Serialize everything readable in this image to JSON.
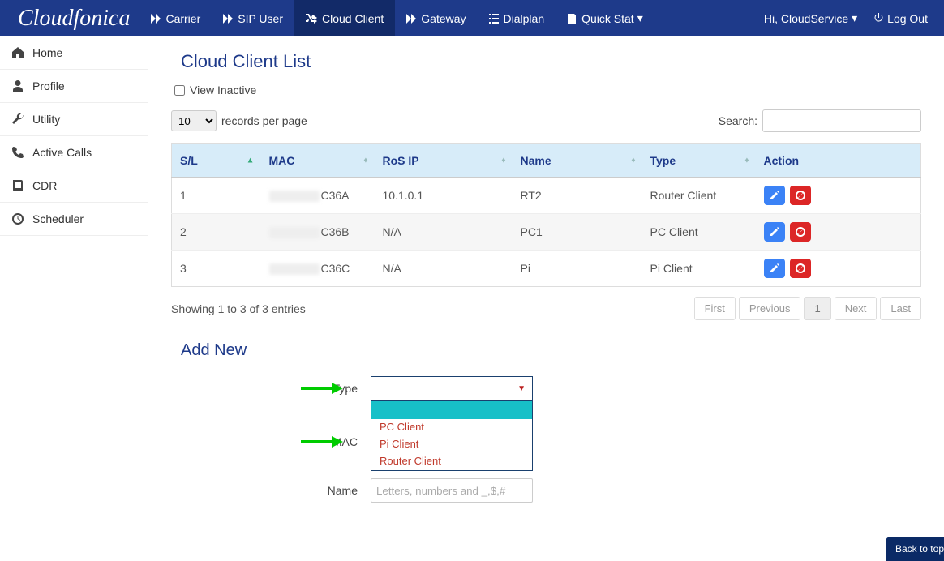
{
  "brand": "Cloudfonica",
  "topnav": {
    "items": [
      {
        "label": "Carrier"
      },
      {
        "label": "SIP User"
      },
      {
        "label": "Cloud Client",
        "active": true
      },
      {
        "label": "Gateway"
      },
      {
        "label": "Dialplan"
      },
      {
        "label": "Quick Stat"
      }
    ]
  },
  "user": {
    "greeting": "Hi, CloudService",
    "logout": "Log Out"
  },
  "sidebar": {
    "items": [
      {
        "label": "Home"
      },
      {
        "label": "Profile"
      },
      {
        "label": "Utility"
      },
      {
        "label": "Active Calls"
      },
      {
        "label": "CDR"
      },
      {
        "label": "Scheduler"
      }
    ]
  },
  "page": {
    "title": "Cloud Client List",
    "view_inactive": "View Inactive",
    "records_per_page": {
      "value": "10",
      "suffix": "records per page"
    },
    "search_label": "Search:",
    "columns": [
      "S/L",
      "MAC",
      "RoS IP",
      "Name",
      "Type",
      "Action"
    ],
    "rows": [
      {
        "sl": "1",
        "mac_suffix": "C36A",
        "rosip": "10.1.0.1",
        "name": "RT2",
        "type": "Router Client"
      },
      {
        "sl": "2",
        "mac_suffix": "C36B",
        "rosip": "N/A",
        "name": "PC1",
        "type": "PC Client"
      },
      {
        "sl": "3",
        "mac_suffix": "C36C",
        "rosip": "N/A",
        "name": "Pi",
        "type": "Pi Client"
      }
    ],
    "showing": "Showing 1 to 3 of 3 entries",
    "pager": {
      "first": "First",
      "prev": "Previous",
      "page": "1",
      "next": "Next",
      "last": "Last"
    }
  },
  "addnew": {
    "title": "Add New",
    "type_label": "Type",
    "mac_label": "MAC",
    "name_label": "Name",
    "name_placeholder": "Letters, numbers and _,$,#",
    "options": [
      "PC Client",
      "Pi Client",
      "Router Client"
    ]
  },
  "back_to_top": "Back to top"
}
